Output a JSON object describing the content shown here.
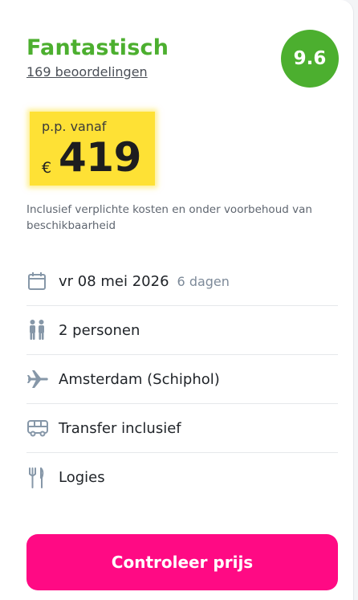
{
  "rating": {
    "label": "Fantastisch",
    "reviews_link": "169 beoordelingen",
    "score": "9.6",
    "color": "#4caf2f"
  },
  "price": {
    "prefix": "p.p. vanaf",
    "currency": "€",
    "amount": "419",
    "highlight_color": "#fee135"
  },
  "disclaimer": "Inclusief verplichte kosten en onder voorbehoud van beschikbaarheid",
  "details": [
    {
      "icon": "calendar-icon",
      "text": "vr 08 mei 2026",
      "sub": "6 dagen"
    },
    {
      "icon": "persons-icon",
      "text": "2 personen"
    },
    {
      "icon": "airplane-icon",
      "text": "Amsterdam (Schiphol)"
    },
    {
      "icon": "bus-icon",
      "text": "Transfer inclusief"
    },
    {
      "icon": "cutlery-icon",
      "text": "Logies"
    }
  ],
  "cta": {
    "label": "Controleer prijs",
    "color": "#ff0a84"
  }
}
